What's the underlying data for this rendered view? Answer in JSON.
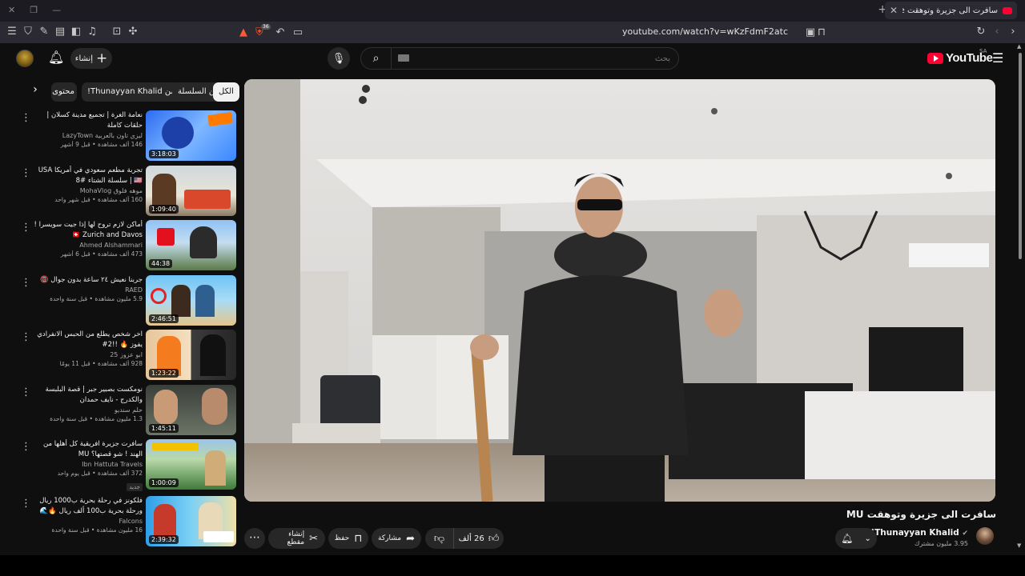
{
  "browser": {
    "tab_title": "سافرت الى جزيرة وتوهقت YouTube",
    "url": "youtube.com/watch?v=wKzFdmF2atc",
    "shield_badge": "36"
  },
  "header": {
    "create_label": "إنشاء",
    "search_placeholder": "بحث",
    "logo_text": "YouTube",
    "country_code": "SA"
  },
  "chips": [
    "الكل",
    "من السلسلة",
    "من Thunayyan Khalid!",
    "محتوى"
  ],
  "related": [
    {
      "title": "نعامة الغرة | تجميع مدينة كسلان | حلقات كاملة",
      "channel": "ليزي تاون بالعربية LazyTown",
      "stats": "146 ألف مشاهدة • قبل 9 أشهر",
      "duration": "3:18:03",
      "badge": ""
    },
    {
      "title": "تجربة مطعم سعودي في أمريكا USA🇺🇸 | سلسلة الشتاء #8",
      "channel": "موهه فلوق MohaVlog",
      "stats": "160 ألف مشاهدة • قبل شهر واحد",
      "duration": "1:09:40",
      "badge": ""
    },
    {
      "title": "أماكن لازم تروح لها إذا جيت سويسرا ! 🇨🇭 Zurich and Davos",
      "channel": "Ahmed Alshammari",
      "stats": "473 ألف مشاهدة • قبل 6 أشهر",
      "duration": "44:38",
      "badge": ""
    },
    {
      "title": "جربنا نعيش ٢٤ ساعة بدون جوال 📵",
      "channel": "RAED",
      "stats": "5.9 مليون مشاهدة • قبل سنة واحدة",
      "duration": "2:46:51",
      "badge": ""
    },
    {
      "title": "اخر شخص يطلع من الحبس الانفرادي يفوز 🔥 !!2#",
      "channel": "ابو عزوز 25",
      "stats": "928 ألف مشاهدة • قبل 11 يومًا",
      "duration": "1:23:22",
      "badge": ""
    },
    {
      "title": "نومكست بصبير جبر | قصة البلبسة والكدرج - نايف حمدان",
      "channel": "حلم سنديو",
      "stats": "1.3 مليون مشاهدة • قبل سنة واحدة",
      "duration": "1:45:11",
      "badge": ""
    },
    {
      "title": "سافرت جزيرة افريقية كل أهلها من الهند ! شو قصتها؟ MU",
      "channel": "Ibn Hattuta Travels",
      "stats": "372 ألف مشاهدة • قبل يوم واحد",
      "duration": "1:00:09",
      "badge": "جديد"
    },
    {
      "title": "فلكونز في رحلة بحرية ب1000 ريال ورحلة بحرية ب100 ألف ريال 🔥🌊",
      "channel": "Falcons",
      "stats": "16 مليون مشاهدة • قبل سنة واحدة",
      "duration": "2:39:32",
      "badge": ""
    }
  ],
  "video": {
    "title": "سافرت الى جزيرة وتوهقت MU",
    "channel_name": "Thunayyan Khalid!",
    "subscribers": "3.95 مليون مشترك",
    "likes": "26 ألف",
    "share_label": "مشاركة",
    "save_label": "حفظ",
    "clip_label": "إنشاء مقطع"
  },
  "colors": {
    "background": "#0f0f0f",
    "chip": "#272727",
    "brand_red": "#ff0033",
    "text_secondary": "#aaaaaa"
  }
}
